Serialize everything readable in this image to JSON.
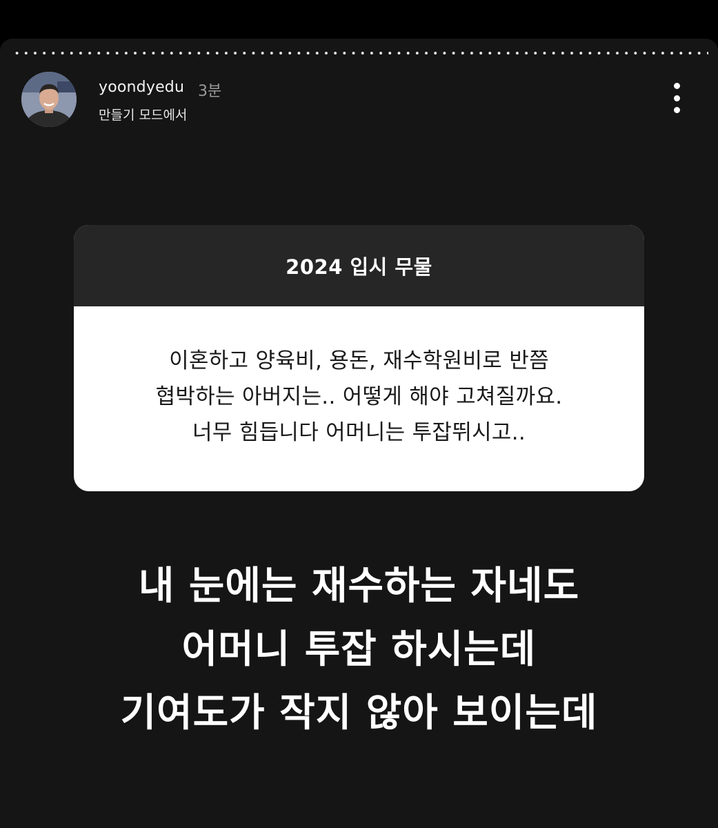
{
  "story": {
    "progress": 0.0,
    "header": {
      "username": "yoondyedu",
      "time_ago": "3분",
      "subtitle": "만들기 모드에서",
      "avatar_icon": "profile-photo",
      "more_icon": "more-vertical-icon"
    },
    "question_card": {
      "title": "2024 입시 무물",
      "lines": [
        "이혼하고 양육비, 용돈, 재수학원비로 반쯤",
        "협박하는 아버지는.. 어떻게 해야 고쳐질까요.",
        "너무 힘듭니다 어머니는 투잡뛰시고.."
      ]
    },
    "answer_lines": [
      "내 눈에는 재수하는 자네도",
      "어머니 투잡 하시는데",
      "기여도가 작지 않아 보이는데"
    ]
  },
  "colors": {
    "background": "#000000",
    "story_bg": "#151515",
    "card_header": "#262626",
    "card_body": "#ffffff"
  }
}
